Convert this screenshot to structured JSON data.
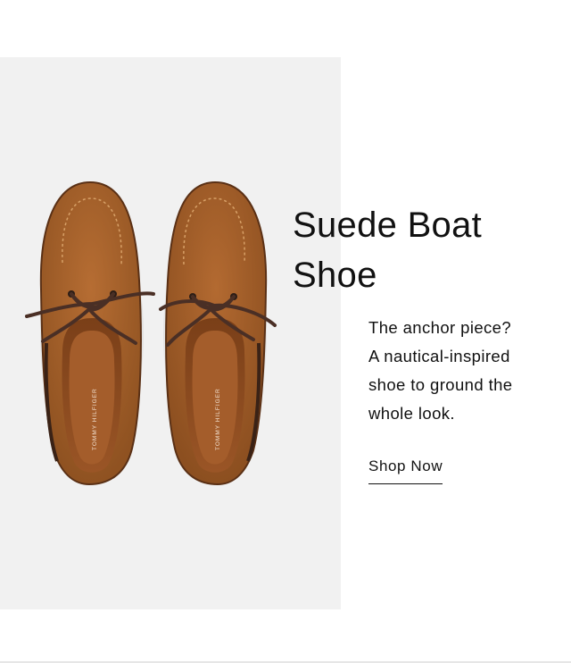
{
  "product": {
    "title_line1": "Suede Boat",
    "title_line2": "Shoe",
    "description_lines": [
      "The anchor piece?",
      "A nautical-inspired",
      "shoe to ground the",
      "whole look."
    ],
    "cta_label": "Shop Now",
    "insole_brand": "TOMMY HILFIGER"
  },
  "colors": {
    "panel_bg": "#f1f1f1",
    "suede": "#a5612c",
    "lace": "#4a2f25",
    "text": "#111111"
  }
}
